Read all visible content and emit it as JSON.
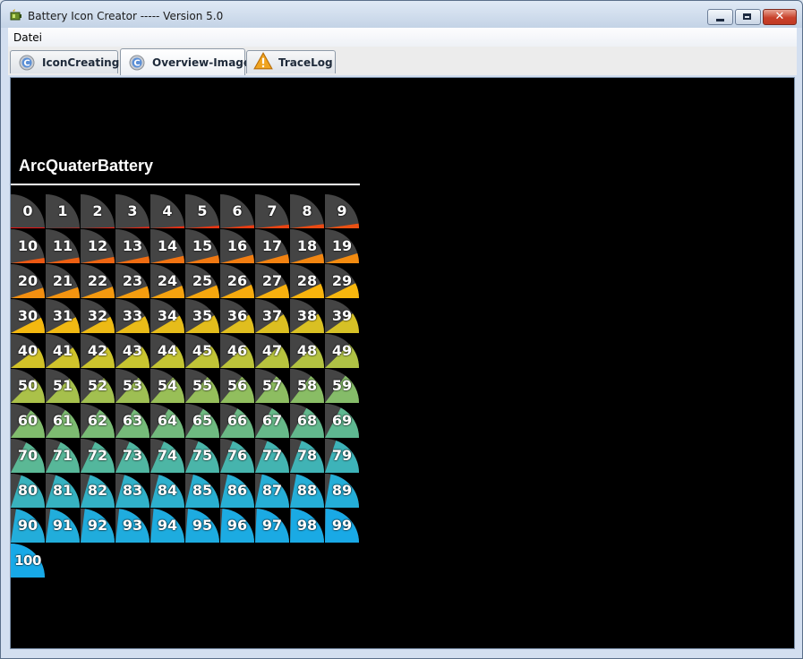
{
  "window": {
    "title": "Battery Icon Creator ----- Version 5.0",
    "app_icon": "battery-app-icon",
    "controls": {
      "minimize_icon": "minimize-icon",
      "maximize_icon": "maximize-icon",
      "close_icon": "close-icon"
    }
  },
  "menubar": {
    "items": [
      {
        "label": "Datei"
      }
    ]
  },
  "tabs": [
    {
      "label": "IconCreating",
      "icon": "app-c-icon",
      "active": false
    },
    {
      "label": "Overview-Image",
      "icon": "app-c-icon",
      "active": true
    },
    {
      "label": "TraceLog",
      "icon": "warning-icon",
      "active": false
    }
  ],
  "overview": {
    "heading": "ArcQuaterBattery",
    "icon_values": [
      0,
      1,
      2,
      3,
      4,
      5,
      6,
      7,
      8,
      9,
      10,
      11,
      12,
      13,
      14,
      15,
      16,
      17,
      18,
      19,
      20,
      21,
      22,
      23,
      24,
      25,
      26,
      27,
      28,
      29,
      30,
      31,
      32,
      33,
      34,
      35,
      36,
      37,
      38,
      39,
      40,
      41,
      42,
      43,
      44,
      45,
      46,
      47,
      48,
      49,
      50,
      51,
      52,
      53,
      54,
      55,
      56,
      57,
      58,
      59,
      60,
      61,
      62,
      63,
      64,
      65,
      66,
      67,
      68,
      69,
      70,
      71,
      72,
      73,
      74,
      75,
      76,
      77,
      78,
      79,
      80,
      81,
      82,
      83,
      84,
      85,
      86,
      87,
      88,
      89,
      90,
      91,
      92,
      93,
      94,
      95,
      96,
      97,
      98,
      99,
      100
    ],
    "colors": {
      "background": "#000000",
      "empty_arc": "#444444",
      "gradient_stops": [
        "#e31414",
        "#f07512",
        "#f8b70d",
        "#c9c52f",
        "#8cbd62",
        "#55b79b",
        "#27afd4",
        "#18a9e7"
      ]
    }
  }
}
